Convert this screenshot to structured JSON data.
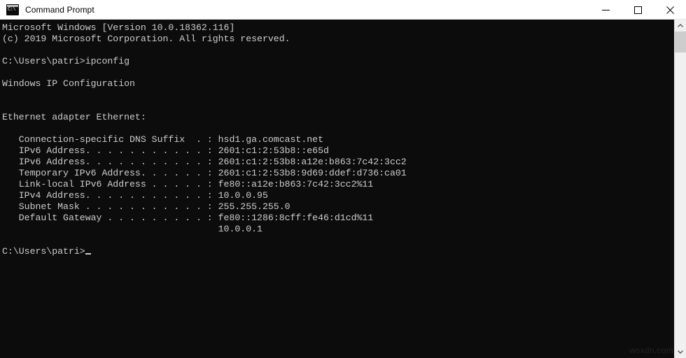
{
  "window": {
    "title": "Command Prompt",
    "icon": "console-icon",
    "icon_glyph": "C:\\",
    "background": "#0c0c0c",
    "foreground": "#cccccc",
    "titlebar_background": "#ffffff"
  },
  "controls": {
    "minimize": "minimize-button",
    "maximize": "maximize-button",
    "close": "close-button"
  },
  "console": {
    "lines": [
      "Microsoft Windows [Version 10.0.18362.116]",
      "(c) 2019 Microsoft Corporation. All rights reserved.",
      "",
      "C:\\Users\\patri>ipconfig",
      "",
      "Windows IP Configuration",
      "",
      "",
      "Ethernet adapter Ethernet:",
      "",
      "   Connection-specific DNS Suffix  . : hsd1.ga.comcast.net",
      "   IPv6 Address. . . . . . . . . . . : 2601:c1:2:53b8::e65d",
      "   IPv6 Address. . . . . . . . . . . : 2601:c1:2:53b8:a12e:b863:7c42:3cc2",
      "   Temporary IPv6 Address. . . . . . : 2601:c1:2:53b8:9d69:ddef:d736:ca01",
      "   Link-local IPv6 Address . . . . . : fe80::a12e:b863:7c42:3cc2%11",
      "   IPv4 Address. . . . . . . . . . . : 10.0.0.95",
      "   Subnet Mask . . . . . . . . . . . : 255.255.255.0",
      "   Default Gateway . . . . . . . . . : fe80::1286:8cff:fe46:d1cd%11",
      "                                       10.0.0.1",
      "",
      "C:\\Users\\patri>"
    ],
    "prompt": "C:\\Users\\patri>",
    "command_entered": "ipconfig",
    "adapter": {
      "name": "Ethernet adapter Ethernet:",
      "fields": [
        {
          "label": "Connection-specific DNS Suffix",
          "value": "hsd1.ga.comcast.net"
        },
        {
          "label": "IPv6 Address",
          "value": "2601:c1:2:53b8::e65d"
        },
        {
          "label": "IPv6 Address",
          "value": "2601:c1:2:53b8:a12e:b863:7c42:3cc2"
        },
        {
          "label": "Temporary IPv6 Address",
          "value": "2601:c1:2:53b8:9d69:ddef:d736:ca01"
        },
        {
          "label": "Link-local IPv6 Address",
          "value": "fe80::a12e:b863:7c42:3cc2%11"
        },
        {
          "label": "IPv4 Address",
          "value": "10.0.0.95"
        },
        {
          "label": "Subnet Mask",
          "value": "255.255.255.0"
        },
        {
          "label": "Default Gateway",
          "value": "fe80::1286:8cff:fe46:d1cd%11"
        },
        {
          "label": "",
          "value": "10.0.0.1"
        }
      ]
    }
  },
  "scrollbar": {
    "up_arrow": "scroll-up-arrow-icon",
    "down_arrow": "scroll-down-arrow-icon"
  },
  "watermark": "wsxdn.com"
}
